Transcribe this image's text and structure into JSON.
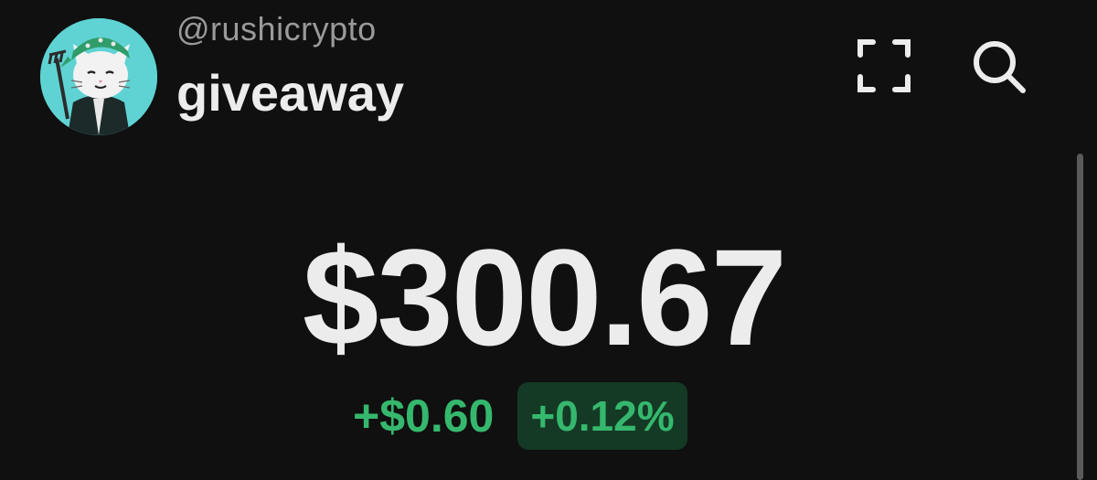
{
  "header": {
    "handle": "@rushicrypto",
    "account_name": "giveaway",
    "avatar_icon": "cat-avatar-icon",
    "expand_icon": "expand-icon",
    "search_icon": "search-icon"
  },
  "balance": {
    "amount": "$300.67",
    "change_amount": "+$0.60",
    "change_percent": "+0.12%"
  },
  "colors": {
    "background": "#101010",
    "text_primary": "#ececec",
    "text_secondary": "#9a9a9a",
    "positive": "#35b86d",
    "positive_badge_bg": "#143a25",
    "avatar_bg": "#5fd3d3"
  }
}
